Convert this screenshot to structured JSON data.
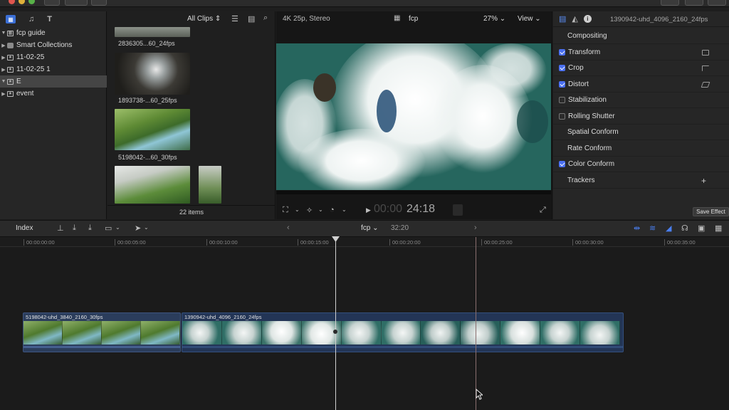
{
  "library": {
    "items": [
      {
        "label": "fcp guide",
        "disclosure": "▼"
      },
      {
        "label": "Smart Collections",
        "disclosure": "▶"
      },
      {
        "label": "11-02-25",
        "disclosure": "▶"
      },
      {
        "label": "11-02-25 1",
        "disclosure": "▶"
      },
      {
        "label": "E",
        "disclosure": "▼",
        "selected": true
      },
      {
        "label": "event",
        "disclosure": "▶"
      }
    ]
  },
  "browser": {
    "filter": "All Clips",
    "clips": [
      {
        "label": "2836305...60_24fps"
      },
      {
        "label": "1893738-...60_25fps"
      },
      {
        "label": "5198042-...60_30fps"
      }
    ],
    "item_count": "22 items"
  },
  "viewer": {
    "format": "4K 25p, Stereo",
    "project": "fcp",
    "zoom": "27%",
    "view_menu": "View",
    "timecode_dim": "00:00",
    "timecode": "24:18"
  },
  "inspector": {
    "clip_name": "1390942-uhd_4096_2160_24fps",
    "rows": [
      {
        "label": "Compositing",
        "checkbox": "none"
      },
      {
        "label": "Transform",
        "checkbox": "on"
      },
      {
        "label": "Crop",
        "checkbox": "on"
      },
      {
        "label": "Distort",
        "checkbox": "on"
      },
      {
        "label": "Stabilization",
        "checkbox": "off"
      },
      {
        "label": "Rolling Shutter",
        "checkbox": "off"
      },
      {
        "label": "Spatial Conform",
        "checkbox": "none"
      },
      {
        "label": "Rate Conform",
        "checkbox": "none"
      },
      {
        "label": "Color Conform",
        "checkbox": "on"
      },
      {
        "label": "Trackers",
        "checkbox": "none",
        "action": "+"
      }
    ],
    "save_effect": "Save Effect"
  },
  "timeline": {
    "index_label": "Index",
    "project": "fcp",
    "duration": "32:20",
    "ruler": [
      "00:00:00:00",
      "00:00:05:00",
      "00:00:10:00",
      "00:00:15:00",
      "00:00:20:00",
      "00:00:25:00",
      "00:00:30:00",
      "00:00:35:00"
    ],
    "clips": [
      {
        "name": "5198042-uhd_3840_2160_30fps"
      },
      {
        "name": "1390942-uhd_4096_2160_24fps"
      }
    ]
  },
  "colors": {
    "accent": "#4a6ff0",
    "clip_blue": "#2c3f66",
    "playhead": "#d0d0d0"
  }
}
